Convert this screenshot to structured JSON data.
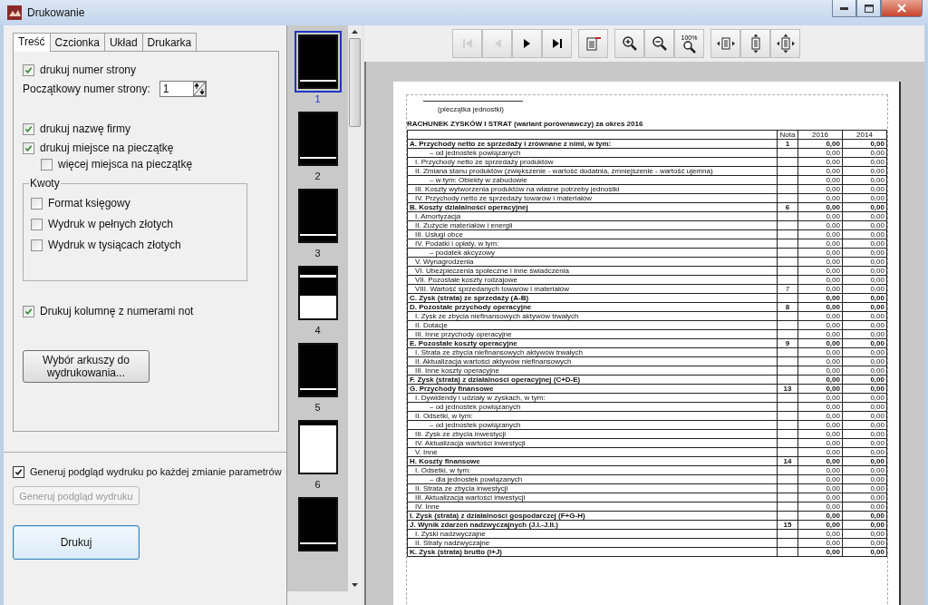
{
  "window": {
    "title": "Drukowanie"
  },
  "left_panel": {
    "tabs": [
      {
        "label": "Treść",
        "selected": true
      },
      {
        "label": "Czcionka",
        "selected": false
      },
      {
        "label": "Układ",
        "selected": false
      },
      {
        "label": "Drukarka",
        "selected": false
      }
    ],
    "options": [
      {
        "kind": "checkbox",
        "label": "drukuj numer strony",
        "checked": true
      },
      {
        "kind": "spin",
        "label": "Początkowy numer strony:",
        "value": "1"
      },
      {
        "kind": "checkbox",
        "label": "drukuj nazwę firmy",
        "checked": true
      },
      {
        "kind": "checkbox",
        "label": "drukuj miejsce na pieczątkę",
        "checked": true,
        "children": [
          {
            "kind": "checkbox",
            "label": "więcej miejsca na pieczątkę",
            "checked": false
          }
        ]
      },
      {
        "kind": "group",
        "label": "Kwoty",
        "children": [
          {
            "kind": "checkbox",
            "label": "Format księgowy",
            "checked": false
          },
          {
            "kind": "checkbox",
            "label": "Wydruk w pełnych złotych",
            "checked": false
          },
          {
            "kind": "checkbox",
            "label": "Wydruk w tysiącach złotych",
            "checked": false
          }
        ]
      },
      {
        "kind": "checkbox",
        "label": "Drukuj kolumnę z numerami not",
        "checked": true
      },
      {
        "kind": "button",
        "label": "Wybór arkuszy do wydrukowania..."
      }
    ],
    "preview_auto": {
      "label": "Generuj podgląd wydruku po każdej zmianie parametrów",
      "checked": true
    },
    "preview_button": {
      "label": "Generuj podgląd wydruku",
      "disabled": true
    },
    "print_button": {
      "label": "Drukuj"
    }
  },
  "thumbnails": [
    {
      "label": "1",
      "selected": true,
      "kind": "dark"
    },
    {
      "label": "2",
      "selected": false,
      "kind": "dark"
    },
    {
      "label": "3",
      "selected": false,
      "kind": "dark"
    },
    {
      "label": "4",
      "selected": false,
      "kind": "half"
    },
    {
      "label": "5",
      "selected": false,
      "kind": "dark"
    },
    {
      "label": "6",
      "selected": false,
      "kind": "light"
    },
    {
      "selected": false,
      "kind": "dark"
    }
  ],
  "toolbar": {
    "groups": [
      {
        "buttons": [
          {
            "kind": "first",
            "disabled": true
          },
          {
            "kind": "prev",
            "disabled": true
          },
          {
            "kind": "next",
            "disabled": false
          },
          {
            "kind": "last",
            "disabled": false
          }
        ]
      },
      {
        "buttons": [
          {
            "kind": "page-setup",
            "disabled": false
          }
        ]
      },
      {
        "buttons": [
          {
            "kind": "zoom-in",
            "disabled": false
          },
          {
            "kind": "zoom-out",
            "disabled": false
          },
          {
            "kind": "zoom-100",
            "label": "100%",
            "disabled": false
          }
        ]
      },
      {
        "buttons": [
          {
            "kind": "fit-width",
            "disabled": false
          },
          {
            "kind": "fit-height",
            "disabled": false
          },
          {
            "kind": "fit-page",
            "disabled": false
          }
        ]
      }
    ]
  },
  "document": {
    "stamp_label": "(pieczątka jednostki)",
    "title": "RACHUNEK ZYSKÓW I STRAT (wariant porównawczy) za okres 2016",
    "columns": [
      "Nota",
      "2016",
      "2014"
    ],
    "rows": [
      {
        "kind": "section",
        "label": "A. Przychody netto ze sprzedaży i zrównane z nimi, w tym:",
        "nota": "1",
        "v1": "0,00",
        "v2": "0,00"
      },
      {
        "kind": "sub",
        "label": "– od jednostek powiązanych",
        "v1": "0,00",
        "v2": "0,00"
      },
      {
        "kind": "item",
        "label": "I. Przychody netto ze sprzedaży produktów",
        "v1": "0,00",
        "v2": "0,00"
      },
      {
        "kind": "item",
        "label": "II. Zmiana stanu produktów (zwiększenie - wartość dodatnia, zmniejszenie - wartość ujemna)",
        "v1": "0,00",
        "v2": "0,00"
      },
      {
        "kind": "sub",
        "label": "– w tym: Obiekty w zabudowie",
        "v1": "0,00",
        "v2": "0,00"
      },
      {
        "kind": "item",
        "label": "III. Koszty wytworzenia produktów na własne potrzeby jednostki",
        "v1": "0,00",
        "v2": "0,00"
      },
      {
        "kind": "item",
        "label": "IV. Przychody netto ze sprzedaży towarów i materiałów",
        "v1": "0,00",
        "v2": "0,00"
      },
      {
        "kind": "section",
        "label": "B. Koszty działalności operacyjnej",
        "nota": "6",
        "v1": "0,00",
        "v2": "0,00"
      },
      {
        "kind": "item",
        "label": "I. Amortyzacja",
        "v1": "0,00",
        "v2": "0,00"
      },
      {
        "kind": "item",
        "label": "II. Zużycie materiałów i energii",
        "v1": "0,00",
        "v2": "0,00"
      },
      {
        "kind": "item",
        "label": "III. Usługi obce",
        "v1": "0,00",
        "v2": "0,00"
      },
      {
        "kind": "item",
        "label": "IV. Podatki i opłaty, w tym:",
        "v1": "0,00",
        "v2": "0,00"
      },
      {
        "kind": "sub",
        "label": "– podatek akcyzowy",
        "v1": "0,00",
        "v2": "0,00"
      },
      {
        "kind": "item",
        "label": "V. Wynagrodzenia",
        "v1": "0,00",
        "v2": "0,00"
      },
      {
        "kind": "item",
        "label": "VI. Ubezpieczenia społeczne i inne świadczenia",
        "v1": "0,00",
        "v2": "0,00"
      },
      {
        "kind": "item",
        "label": "VII. Pozostałe koszty rodzajowe",
        "v1": "0,00",
        "v2": "0,00"
      },
      {
        "kind": "item",
        "label": "VIII. Wartość sprzedanych towarów i materiałów",
        "nota": "7",
        "v1": "0,00",
        "v2": "0,00"
      },
      {
        "kind": "section",
        "label": "C. Zysk (strata) ze sprzedaży (A-B)",
        "v1": "0,00",
        "v2": "0,00"
      },
      {
        "kind": "section",
        "label": "D. Pozostałe przychody operacyjne",
        "nota": "8",
        "v1": "0,00",
        "v2": "0,00"
      },
      {
        "kind": "item",
        "label": "I. Zysk ze zbycia niefinansowych aktywów trwałych",
        "v1": "0,00",
        "v2": "0,00"
      },
      {
        "kind": "item",
        "label": "II. Dotacje",
        "v1": "0,00",
        "v2": "0,00"
      },
      {
        "kind": "item",
        "label": "III. Inne przychody operacyjne",
        "v1": "0,00",
        "v2": "0,00"
      },
      {
        "kind": "section",
        "label": "E. Pozostałe koszty operacyjne",
        "nota": "9",
        "v1": "0,00",
        "v2": "0,00"
      },
      {
        "kind": "item",
        "label": "I. Strata ze zbycia niefinansowych aktywów trwałych",
        "v1": "0,00",
        "v2": "0,00"
      },
      {
        "kind": "item",
        "label": "II. Aktualizacja wartości aktywów niefinansowych",
        "v1": "0,00",
        "v2": "0,00"
      },
      {
        "kind": "item",
        "label": "III. Inne koszty operacyjne",
        "v1": "0,00",
        "v2": "0,00"
      },
      {
        "kind": "section",
        "label": "F. Zysk (strata) z działalności operacyjnej (C+D-E)",
        "v1": "0,00",
        "v2": "0,00"
      },
      {
        "kind": "section",
        "label": "G. Przychody finansowe",
        "nota": "13",
        "v1": "0,00",
        "v2": "0,00"
      },
      {
        "kind": "item",
        "label": "I. Dywidendy i udziały w zyskach, w tym:",
        "v1": "0,00",
        "v2": "0,00"
      },
      {
        "kind": "sub",
        "label": "– od jednostek powiązanych",
        "v1": "0,00",
        "v2": "0,00"
      },
      {
        "kind": "item",
        "label": "II. Odsetki, w tym:",
        "v1": "0,00",
        "v2": "0,00"
      },
      {
        "kind": "sub",
        "label": "– od jednostek powiązanych",
        "v1": "0,00",
        "v2": "0,00"
      },
      {
        "kind": "item",
        "label": "III. Zysk ze zbycia inwestycji",
        "v1": "0,00",
        "v2": "0,00"
      },
      {
        "kind": "item",
        "label": "IV. Aktualizacja wartości inwestycji",
        "v1": "0,00",
        "v2": "0,00"
      },
      {
        "kind": "item",
        "label": "V. Inne",
        "v1": "0,00",
        "v2": "0,00"
      },
      {
        "kind": "section",
        "label": "H. Koszty finansowe",
        "nota": "14",
        "v1": "0,00",
        "v2": "0,00"
      },
      {
        "kind": "item",
        "label": "I. Odsetki, w tym:",
        "v1": "0,00",
        "v2": "0,00"
      },
      {
        "kind": "sub",
        "label": "– dla jednostek powiązanych",
        "v1": "0,00",
        "v2": "0,00"
      },
      {
        "kind": "item",
        "label": "II. Strata ze zbycia inwestycji",
        "v1": "0,00",
        "v2": "0,00"
      },
      {
        "kind": "item",
        "label": "III. Aktualizacja wartości inwestycji",
        "v1": "0,00",
        "v2": "0,00"
      },
      {
        "kind": "item",
        "label": "IV. Inne",
        "v1": "0,00",
        "v2": "0,00"
      },
      {
        "kind": "section",
        "label": "I. Zysk (strata) z działalności gospodarczej (F+G-H)",
        "v1": "0,00",
        "v2": "0,00"
      },
      {
        "kind": "section",
        "label": "J. Wynik zdarzeń nadzwyczajnych (J.I.-J.II.)",
        "nota": "15",
        "v1": "0,00",
        "v2": "0,00"
      },
      {
        "kind": "item",
        "label": "I. Zyski nadzwyczajne",
        "v1": "0,00",
        "v2": "0,00"
      },
      {
        "kind": "item",
        "label": "II. Straty nadzwyczajne",
        "v1": "0,00",
        "v2": "0,00"
      },
      {
        "kind": "section",
        "label": "K. Zysk (strata) brutto (I+J)",
        "v1": "0,00",
        "v2": "0,00"
      }
    ]
  }
}
